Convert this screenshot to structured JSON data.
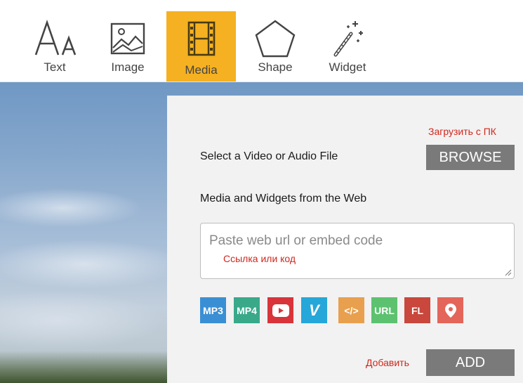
{
  "toolbar": {
    "tools": [
      {
        "label": "Text",
        "icon": "text-size-icon"
      },
      {
        "label": "Image",
        "icon": "image-icon"
      },
      {
        "label": "Media",
        "icon": "film-icon",
        "active": true
      },
      {
        "label": "Shape",
        "icon": "pentagon-icon"
      },
      {
        "label": "Widget",
        "icon": "magic-wand-icon"
      }
    ],
    "active_color": "#f5b121"
  },
  "panel": {
    "upload_hint": "Загрузить с ПК",
    "select_label": "Select a Video or Audio File",
    "browse_label": "BROWSE",
    "web_label": "Media and Widgets from the Web",
    "url_placeholder": "Paste web url or embed code",
    "url_hint": "Ссылка или код",
    "add_hint": "Добавить",
    "add_label": "ADD",
    "media_buttons": [
      {
        "label": "MP3",
        "color": "#3a8fd4"
      },
      {
        "label": "MP4",
        "color": "#39a98a"
      },
      {
        "label": "youtube",
        "color": "#d8343a"
      },
      {
        "label": "V",
        "color": "#26a7d9"
      },
      {
        "label": "</>",
        "color": "#e8a04e"
      },
      {
        "label": "URL",
        "color": "#5cc26f"
      },
      {
        "label": "FL",
        "color": "#c9473c"
      },
      {
        "label": "map-pin",
        "color": "#e4655a"
      }
    ]
  }
}
